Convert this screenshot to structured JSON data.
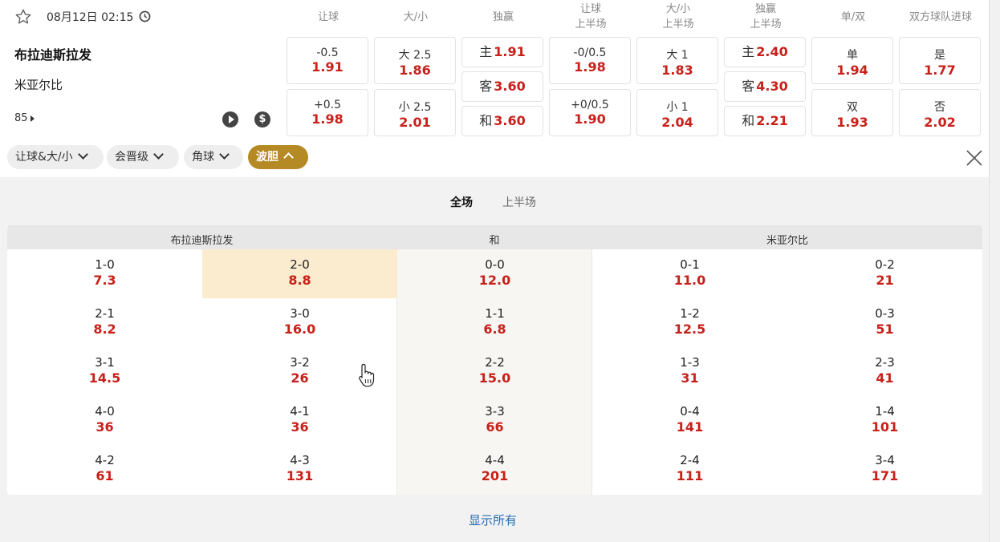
{
  "match": {
    "datetime": "08月12日 02:15",
    "home": "布拉迪斯拉发",
    "away": "米亚尔比",
    "minute": "85"
  },
  "markets": [
    {
      "header": [
        "让球"
      ],
      "cells": [
        {
          "label": "-0.5",
          "odd": "1.91"
        },
        {
          "label": "+0.5",
          "odd": "1.98"
        }
      ]
    },
    {
      "header": [
        "大/小"
      ],
      "cells": [
        {
          "label": "大 2.5",
          "odd": "1.86"
        },
        {
          "label": "小 2.5",
          "odd": "2.01"
        }
      ]
    },
    {
      "header": [
        "独赢"
      ],
      "cells": [
        {
          "label": "主",
          "odd": "1.91"
        },
        {
          "label": "客",
          "odd": "3.60"
        },
        {
          "label": "和",
          "odd": "3.60"
        }
      ]
    },
    {
      "header": [
        "让球",
        "上半场"
      ],
      "cells": [
        {
          "label": "-0/0.5",
          "odd": "1.98"
        },
        {
          "label": "+0/0.5",
          "odd": "1.90"
        }
      ]
    },
    {
      "header": [
        "大/小",
        "上半场"
      ],
      "cells": [
        {
          "label": "大 1",
          "odd": "1.83"
        },
        {
          "label": "小 1",
          "odd": "2.04"
        }
      ]
    },
    {
      "header": [
        "独赢",
        "上半场"
      ],
      "cells": [
        {
          "label": "主",
          "odd": "2.40"
        },
        {
          "label": "客",
          "odd": "4.30"
        },
        {
          "label": "和",
          "odd": "2.21"
        }
      ]
    },
    {
      "header": [
        "单/双"
      ],
      "cells": [
        {
          "label": "单",
          "odd": "1.94"
        },
        {
          "label": "双",
          "odd": "1.93"
        }
      ]
    },
    {
      "header": [
        "双方球队进球"
      ],
      "cells": [
        {
          "label": "是",
          "odd": "1.77"
        },
        {
          "label": "否",
          "odd": "2.02"
        }
      ]
    }
  ],
  "filters": [
    {
      "label": "让球&大/小",
      "active": false
    },
    {
      "label": "会晋级",
      "active": false
    },
    {
      "label": "角球",
      "active": false
    },
    {
      "label": "波胆",
      "active": true
    }
  ],
  "tabs": [
    {
      "label": "全场",
      "active": true
    },
    {
      "label": "上半场",
      "active": false
    }
  ],
  "correct_score": {
    "headers": {
      "home": "布拉迪斯拉发",
      "draw": "和",
      "away": "米亚尔比"
    },
    "highlighted": "2-0",
    "columns": [
      [
        {
          "score": "1-0",
          "odd": "7.3"
        },
        {
          "score": "2-1",
          "odd": "8.2"
        },
        {
          "score": "3-1",
          "odd": "14.5"
        },
        {
          "score": "4-0",
          "odd": "36"
        },
        {
          "score": "4-2",
          "odd": "61"
        }
      ],
      [
        {
          "score": "2-0",
          "odd": "8.8"
        },
        {
          "score": "3-0",
          "odd": "16.0"
        },
        {
          "score": "3-2",
          "odd": "26"
        },
        {
          "score": "4-1",
          "odd": "36"
        },
        {
          "score": "4-3",
          "odd": "131"
        }
      ],
      [
        {
          "score": "0-0",
          "odd": "12.0"
        },
        {
          "score": "1-1",
          "odd": "6.8"
        },
        {
          "score": "2-2",
          "odd": "15.0"
        },
        {
          "score": "3-3",
          "odd": "66"
        },
        {
          "score": "4-4",
          "odd": "201"
        }
      ],
      [
        {
          "score": "0-1",
          "odd": "11.0"
        },
        {
          "score": "1-2",
          "odd": "12.5"
        },
        {
          "score": "1-3",
          "odd": "31"
        },
        {
          "score": "0-4",
          "odd": "141"
        },
        {
          "score": "2-4",
          "odd": "111"
        }
      ],
      [
        {
          "score": "0-2",
          "odd": "21"
        },
        {
          "score": "0-3",
          "odd": "51"
        },
        {
          "score": "2-3",
          "odd": "41"
        },
        {
          "score": "1-4",
          "odd": "101"
        },
        {
          "score": "3-4",
          "odd": "171"
        }
      ]
    ]
  },
  "show_all": "显示所有",
  "colors": {
    "odd": "#c8201a",
    "accent": "#b58a24",
    "link": "#2a6db3",
    "highlight": "#fbebcf"
  }
}
